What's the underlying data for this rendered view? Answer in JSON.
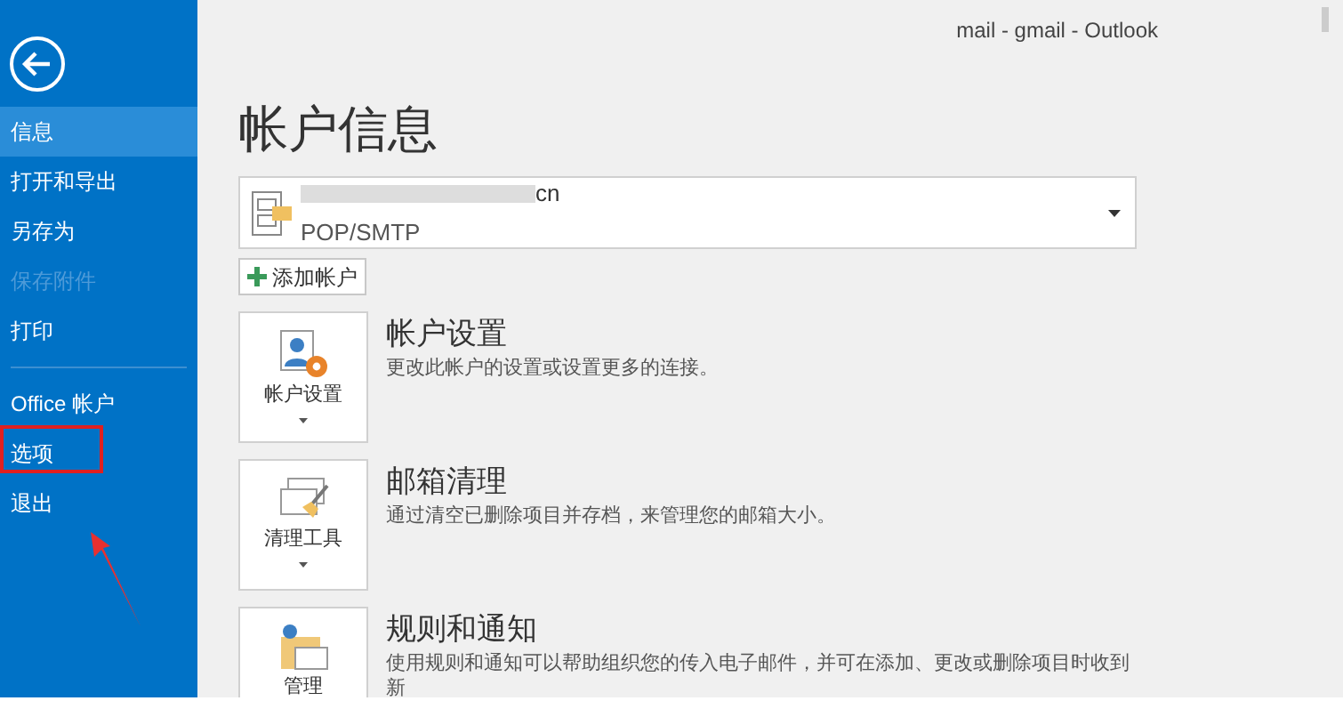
{
  "window": {
    "title": "mail - gmail - Outlook"
  },
  "sidebar": {
    "items": [
      {
        "label": "信息",
        "selected": true,
        "disabled": false,
        "annotated": false
      },
      {
        "label": "打开和导出",
        "selected": false,
        "disabled": false,
        "annotated": false
      },
      {
        "label": "另存为",
        "selected": false,
        "disabled": false,
        "annotated": false
      },
      {
        "label": "保存附件",
        "selected": false,
        "disabled": true,
        "annotated": false
      },
      {
        "label": "打印",
        "selected": false,
        "disabled": false,
        "annotated": false
      },
      {
        "kind": "divider"
      },
      {
        "label": "Office 帐户",
        "selected": false,
        "disabled": false,
        "annotated": false
      },
      {
        "label": "选项",
        "selected": false,
        "disabled": false,
        "annotated": true
      },
      {
        "label": "退出",
        "selected": false,
        "disabled": false,
        "annotated": false
      }
    ]
  },
  "page": {
    "heading": "帐户信息",
    "account": {
      "address": "cn",
      "type": "POP/SMTP"
    },
    "add_account": "添加帐户",
    "sections": [
      {
        "kind": "account",
        "dropdown": true,
        "button": "帐户设置",
        "title": "帐户设置",
        "description": "更改此帐户的设置或设置更多的连接。"
      },
      {
        "kind": "cleanup",
        "dropdown": true,
        "button": "清理工具",
        "title": "邮箱清理",
        "description": "通过清空已删除项目并存档，来管理您的邮箱大小。"
      },
      {
        "kind": "rules",
        "button": "管理",
        "title": "规则和通知",
        "description": "使用规则和通知可以帮助组织您的传入电子邮件，并可在添加、更改或删除项目时收到",
        "description_2": "新"
      }
    ]
  }
}
